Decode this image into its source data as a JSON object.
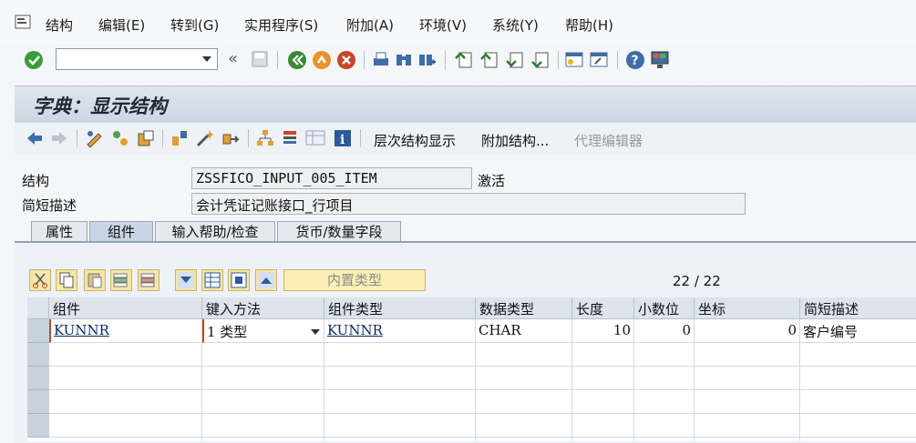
{
  "menu": {
    "items": [
      "结构",
      "编辑(E)",
      "转到(G)",
      "实用程序(S)",
      "附加(A)",
      "环境(V)",
      "系统(Y)",
      "帮助(H)"
    ]
  },
  "title": "字典：显示结构",
  "app_toolbar": {
    "hierarchy_label": "层次结构显示",
    "append_label": "附加结构...",
    "proxy_label": "代理编辑器"
  },
  "form": {
    "structure_label": "结构",
    "structure_value": "ZSSFICO_INPUT_005_ITEM",
    "status": "激活",
    "desc_label": "简短描述",
    "desc_value": "会计凭证记账接口_行项目"
  },
  "tabs": [
    "属性",
    "组件",
    "输入帮助/检查",
    "货币/数量字段"
  ],
  "table_toolbar": {
    "builtin_type_label": "内置类型",
    "pager": "22 / 22"
  },
  "grid": {
    "columns": [
      "组件",
      "键入方法",
      "组件类型",
      "数据类型",
      "长度",
      "小数位",
      "坐标",
      "简短描述"
    ],
    "rows": [
      {
        "component": "KUNNR",
        "typing": "1 类型",
        "comp_type": "KUNNR",
        "data_type": "CHAR",
        "length": "10",
        "decimals": "0",
        "coord": "0",
        "desc": "客户编号"
      }
    ]
  },
  "colors": {
    "accent": "#2f7a2f",
    "title_bg": "#cdd6e0",
    "tab_active": "#c9d5e2"
  }
}
